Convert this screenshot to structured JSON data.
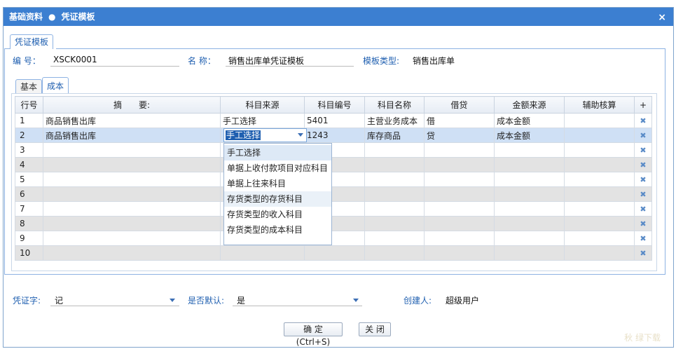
{
  "window": {
    "title_left": "基础资料",
    "title_sep": "●",
    "title_right": "凭证模板",
    "close": "×"
  },
  "outer_tab": "凭证模板",
  "header": {
    "code_label": "编 号：",
    "code_value": "XSCK0001",
    "name_label": "名 称：",
    "name_value": "销售出库单凭证模板",
    "type_label": "模板类型:",
    "type_value": "销售出库单"
  },
  "inner_tabs": [
    "基本",
    "成本"
  ],
  "grid": {
    "headers": [
      "行号",
      "摘　　要:",
      "科目来源",
      "科目编号",
      "科目名称",
      "借贷",
      "金额来源",
      "辅助核算",
      "+"
    ],
    "rows": [
      [
        "1",
        "商品销售出库",
        "手工选择",
        "5401",
        "主营业务成本",
        "借",
        "成本金额",
        ""
      ],
      [
        "2",
        "商品销售出库",
        "",
        "1243",
        "库存商品",
        "贷",
        "成本金额",
        ""
      ],
      [
        "3",
        "",
        "",
        "",
        "",
        "",
        "",
        ""
      ],
      [
        "4",
        "",
        "",
        "",
        "",
        "",
        "",
        ""
      ],
      [
        "5",
        "",
        "",
        "",
        "",
        "",
        "",
        ""
      ],
      [
        "6",
        "",
        "",
        "",
        "",
        "",
        "",
        ""
      ],
      [
        "7",
        "",
        "",
        "",
        "",
        "",
        "",
        ""
      ],
      [
        "8",
        "",
        "",
        "",
        "",
        "",
        "",
        ""
      ],
      [
        "9",
        "",
        "",
        "",
        "",
        "",
        "",
        ""
      ],
      [
        "10",
        "",
        "",
        "",
        "",
        "",
        "",
        ""
      ]
    ]
  },
  "editor": {
    "value": "手工选择"
  },
  "dropdown": {
    "options": [
      "手工选择",
      "单据上收付款项目对应科目",
      "单据上往来科目",
      "存货类型的存货科目",
      "存货类型的收入科目",
      "存货类型的成本科目"
    ]
  },
  "footer": {
    "voucher_label": "凭证字:",
    "voucher_value": "记",
    "default_label": "是否默认:",
    "default_value": "是",
    "creator_label": "创建人:",
    "creator_value": "超级用户"
  },
  "buttons": {
    "ok": "确 定(Ctrl+S)",
    "close": "关 闭"
  },
  "watermark": "秋 绿下载",
  "colors": {
    "title_bar": "#3c7fd1",
    "label_blue": "#1f5fb0",
    "row_selected": "#cfe0f5",
    "row_alt": "#e3e3e3"
  }
}
